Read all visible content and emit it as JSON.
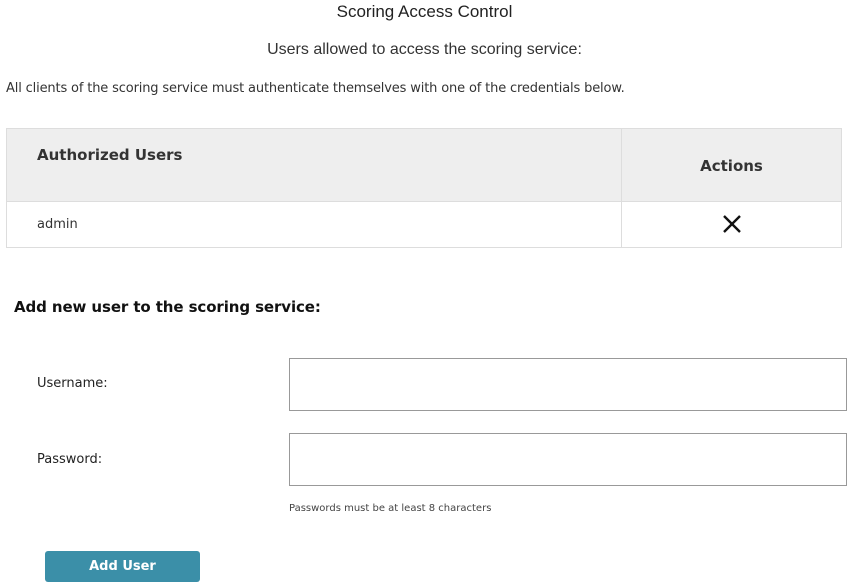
{
  "header": {
    "title": "Scoring Access Control",
    "subtitle": "Users allowed to access the scoring service:",
    "description": "All clients of the scoring service must authenticate themselves with one of the credentials below."
  },
  "users_table": {
    "columns": [
      "Authorized Users",
      "Actions"
    ],
    "rows": [
      {
        "username": "admin",
        "action_icon": "close-icon"
      }
    ]
  },
  "add_user_form": {
    "heading": "Add new user to the scoring service:",
    "username_label": "Username:",
    "username_value": "",
    "password_label": "Password:",
    "password_value": "",
    "password_hint": "Passwords must be at least 8 characters",
    "submit_label": "Add User"
  },
  "colors": {
    "accent": "#3b8fa8",
    "table_header_bg": "#eeeeee",
    "border": "#dddddd"
  }
}
